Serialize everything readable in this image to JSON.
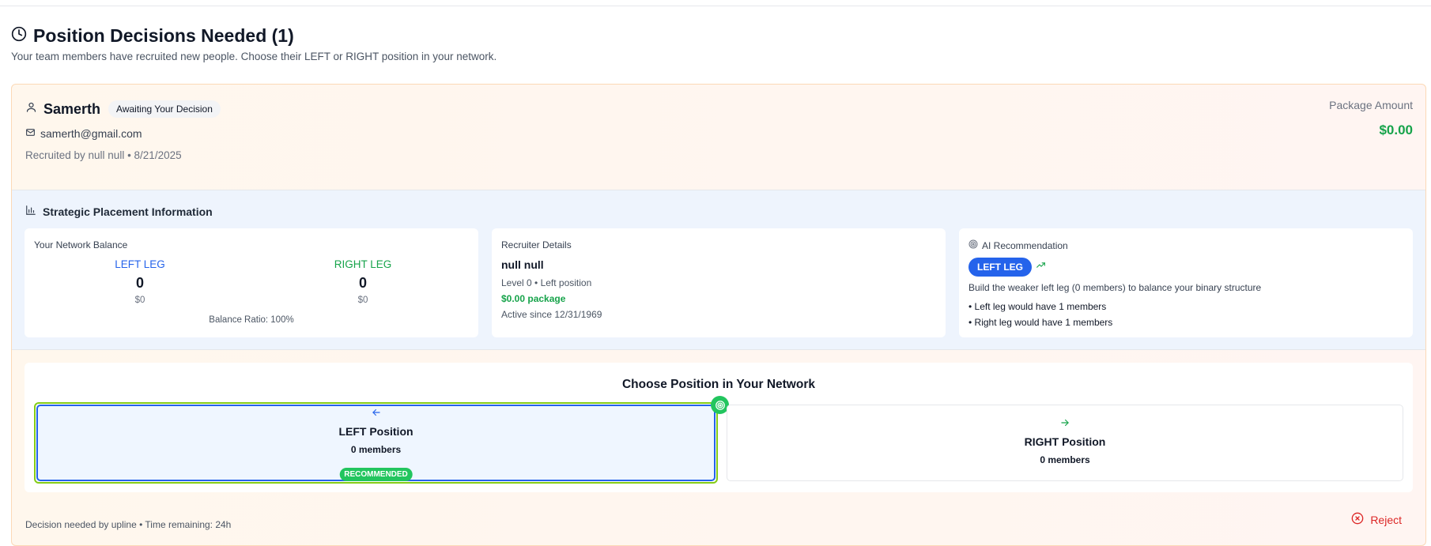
{
  "header": {
    "title": "Position Decisions Needed (1)",
    "subtitle": "Your team members have recruited new people. Choose their LEFT or RIGHT position in your network."
  },
  "candidate": {
    "name": "Samerth",
    "status_badge": "Awaiting Your Decision",
    "email": "samerth@gmail.com",
    "recruited_line": "Recruited by null null • 8/21/2025",
    "package_label": "Package Amount",
    "package_amount": "$0.00"
  },
  "strategic": {
    "title": "Strategic Placement Information",
    "balance": {
      "label": "Your Network Balance",
      "left_name": "LEFT LEG",
      "left_count": "0",
      "left_amount": "$0",
      "right_name": "RIGHT LEG",
      "right_count": "0",
      "right_amount": "$0",
      "ratio": "Balance Ratio: 100%"
    },
    "recruiter": {
      "label": "Recruiter Details",
      "name": "null null",
      "level_line": "Level 0 • Left position",
      "package": "$0.00 package",
      "active": "Active since 12/31/1969"
    },
    "ai": {
      "label": "AI Recommendation",
      "pill": "LEFT LEG",
      "text": "Build the weaker left leg (0 members) to balance your binary structure",
      "bullet1": "• Left leg would have 1 members",
      "bullet2": "• Right leg would have 1 members"
    }
  },
  "choose": {
    "title": "Choose Position in Your Network",
    "left_title": "LEFT Position",
    "left_members": "0 members",
    "recommended": "RECOMMENDED",
    "right_title": "RIGHT Position",
    "right_members": "0 members"
  },
  "footer": {
    "deadline": "Decision needed by upline • Time remaining: 24h",
    "reject_label": "Reject"
  },
  "colors": {
    "blue": "#2563eb",
    "green": "#16a34a",
    "red": "#dc2626"
  },
  "icons": [
    "clock-icon",
    "user-icon",
    "mail-icon",
    "bar-chart-icon",
    "target-icon",
    "trending-up-icon",
    "arrow-left-icon",
    "arrow-right-icon",
    "circle-x-icon"
  ]
}
